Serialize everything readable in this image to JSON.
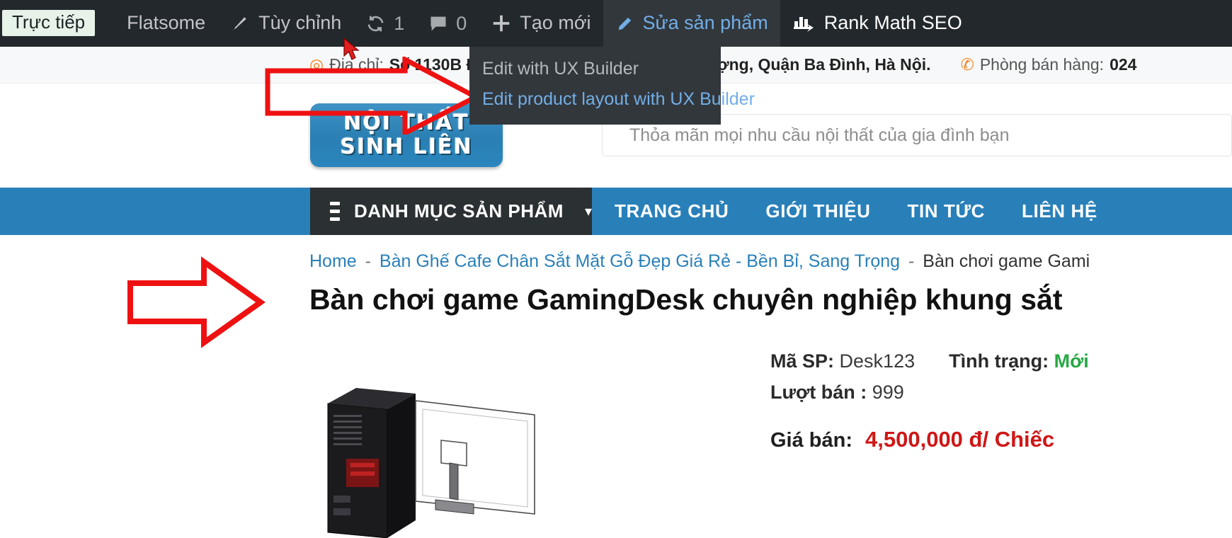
{
  "adminbar": {
    "live_label": "Trực tiếp",
    "items": [
      {
        "name": "flatsome",
        "label": "Flatsome",
        "icon": "flatsome-diamond-icon"
      },
      {
        "name": "customize",
        "label": "Tùy chỉnh",
        "icon": "brush-icon"
      },
      {
        "name": "updates",
        "label": "1",
        "icon": "updates-icon"
      },
      {
        "name": "comments",
        "label": "0",
        "icon": "comment-bubble-icon"
      },
      {
        "name": "new",
        "label": "Tạo mới",
        "icon": "plus-icon"
      },
      {
        "name": "edit-product",
        "label": "Sửa sản phẩm",
        "icon": "pencil-icon"
      },
      {
        "name": "rank-math",
        "label": "Rank Math SEO",
        "icon": "rank-math-icon"
      }
    ],
    "dropdown": {
      "items": [
        {
          "label": "Edit with UX Builder",
          "highlighted": false
        },
        {
          "label": "Edit product layout with UX Builder",
          "highlighted": true
        }
      ]
    }
  },
  "topinfo": {
    "address_label": "Địa chỉ:",
    "address_value": "Số 1130B Đường Láng, Phường Láng Thượng, Quận Ba Đình, Hà Nội.",
    "sales_label": "Phòng bán hàng:",
    "sales_value": "024"
  },
  "logo": {
    "line1": "NỘI THẤT",
    "line2": "SINH LIÊN"
  },
  "search": {
    "placeholder": "Thỏa mãn mọi nhu cầu nội thất của gia đình bạn",
    "value": ""
  },
  "nav": {
    "category_button": "DANH MỤC SẢN PHẨM",
    "links": [
      "TRANG CHỦ",
      "GIỚI THIỆU",
      "TIN TỨC",
      "LIÊN HỆ"
    ]
  },
  "breadcrumb": {
    "home": "Home",
    "category": "Bàn Ghế Cafe Chân Sắt Mặt Gỗ Đẹp Giá Rẻ - Bền Bỉ, Sang Trọng",
    "current": "Bàn chơi game Gami",
    "separator": "-"
  },
  "product": {
    "title": "Bàn chơi game GamingDesk chuyên nghiệp khung sắt",
    "sku_label": "Mã SP:",
    "sku_value": "Desk123",
    "status_label": "Tình trạng:",
    "status_value": "Mới",
    "sold_label": "Lượt bán :",
    "sold_value": "999",
    "price_label": "Giá bán:",
    "price_value": "4,500,000 đ/ Chiếc"
  },
  "colors": {
    "admin_bar": "#23282d",
    "admin_hover": "#32373c",
    "admin_link_blue": "#72aee6",
    "nav_blue": "#2980b9",
    "cat_dark": "#2b3033",
    "accent_orange": "#f5821f",
    "price_red": "#cf1616",
    "status_green": "#27a844",
    "annotation_red": "#ee1111"
  }
}
